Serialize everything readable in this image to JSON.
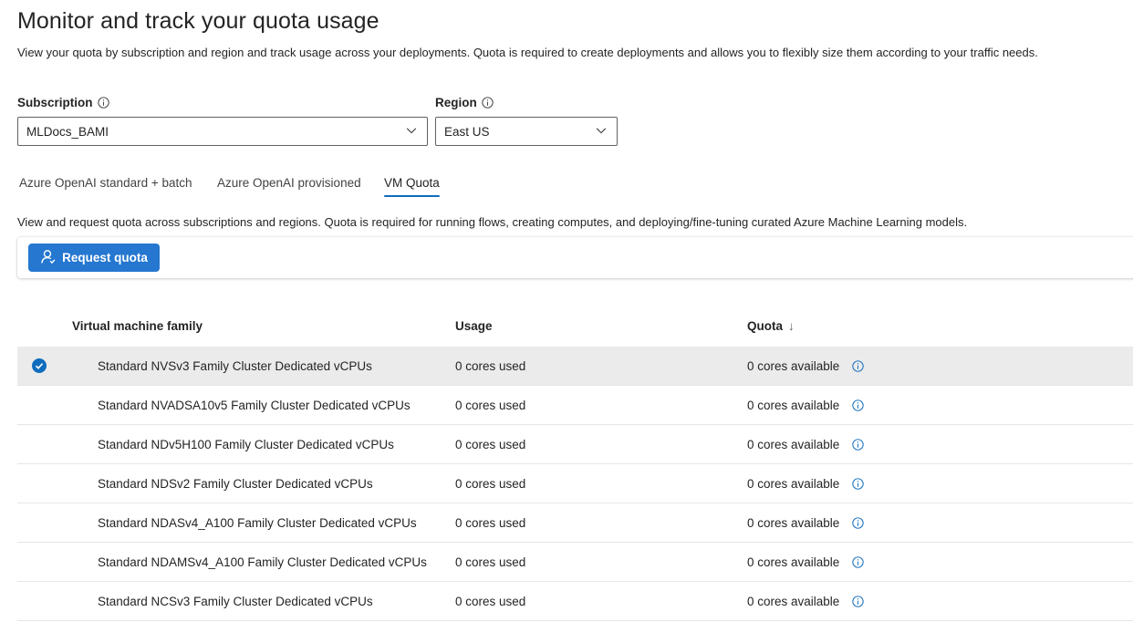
{
  "header": {
    "title": "Monitor and track your quota usage",
    "subtitle": "View your quota by subscription and region and track usage across your deployments. Quota is required to create deployments and allows you to flexibly size them according to your traffic needs."
  },
  "filters": {
    "subscription_label": "Subscription",
    "subscription_value": "MLDocs_BAMI",
    "region_label": "Region",
    "region_value": "East US"
  },
  "tabs": [
    {
      "label": "Azure OpenAI standard + batch",
      "active": false
    },
    {
      "label": "Azure OpenAI provisioned",
      "active": false
    },
    {
      "label": "VM Quota",
      "active": true
    }
  ],
  "vm_quota": {
    "description": "View and request quota across subscriptions and regions. Quota is required for running flows, creating computes, and deploying/fine-tuning curated Azure Machine Learning models.",
    "request_button": "Request quota"
  },
  "table": {
    "columns": {
      "family": "Virtual machine family",
      "usage": "Usage",
      "quota": "Quota"
    },
    "sort_indicator": "↓",
    "rows": [
      {
        "family": "Standard NVSv3 Family Cluster Dedicated vCPUs",
        "usage": "0 cores used",
        "quota": "0 cores available",
        "selected": true
      },
      {
        "family": "Standard NVADSA10v5 Family Cluster Dedicated vCPUs",
        "usage": "0 cores used",
        "quota": "0 cores available",
        "selected": false
      },
      {
        "family": "Standard NDv5H100 Family Cluster Dedicated vCPUs",
        "usage": "0 cores used",
        "quota": "0 cores available",
        "selected": false
      },
      {
        "family": "Standard NDSv2 Family Cluster Dedicated vCPUs",
        "usage": "0 cores used",
        "quota": "0 cores available",
        "selected": false
      },
      {
        "family": "Standard NDASv4_A100 Family Cluster Dedicated vCPUs",
        "usage": "0 cores used",
        "quota": "0 cores available",
        "selected": false
      },
      {
        "family": "Standard NDAMSv4_A100 Family Cluster Dedicated vCPUs",
        "usage": "0 cores used",
        "quota": "0 cores available",
        "selected": false
      },
      {
        "family": "Standard NCSv3 Family Cluster Dedicated vCPUs",
        "usage": "0 cores used",
        "quota": "0 cores available",
        "selected": false
      }
    ]
  },
  "colors": {
    "accent": "#0f6cbd",
    "button": "#2577d0",
    "selected_row": "#ebebeb"
  },
  "icons": {
    "info": "info-icon",
    "chevron": "chevron-down-icon",
    "person": "person-icon",
    "check": "checkmark-circle-icon",
    "sort": "arrow-down-icon"
  }
}
